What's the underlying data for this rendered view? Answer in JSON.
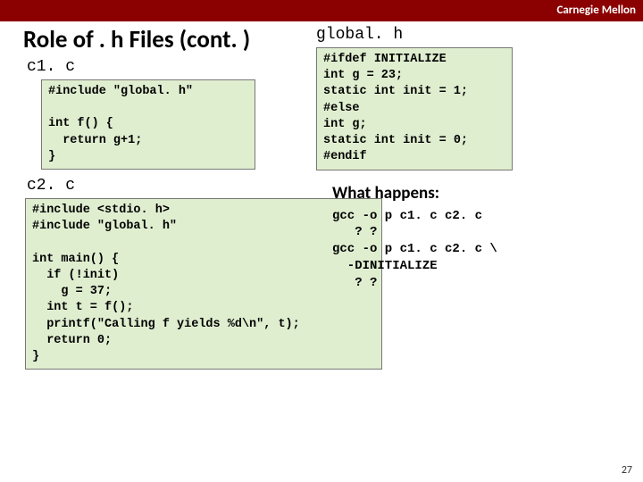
{
  "header": {
    "org": "Carnegie Mellon"
  },
  "title": "Role of . h Files (cont. )",
  "left": {
    "label1": "c1. c",
    "code1": "#include \"global. h\"\n\nint f() {\n  return g+1;\n}",
    "label2": "c2. c",
    "code2": "#include <stdio. h>\n#include \"global. h\"\n\nint main() {\n  if (!init)\n    g = 37;\n  int t = f();\n  printf(\"Calling f yields %d\\n\", t);\n  return 0;\n}"
  },
  "right": {
    "labelh": "global. h",
    "codeh": "#ifdef INITIALIZE\nint g = 23;\nstatic int init = 1;\n#else\nint g;\nstatic int init = 0;\n#endif",
    "what_label": "What happens:",
    "outcome": "gcc -o p c1. c c2. c\n   ? ?\ngcc -o p c1. c c2. c \\\n  -DINITIALIZE\n   ? ?"
  },
  "page": "27"
}
